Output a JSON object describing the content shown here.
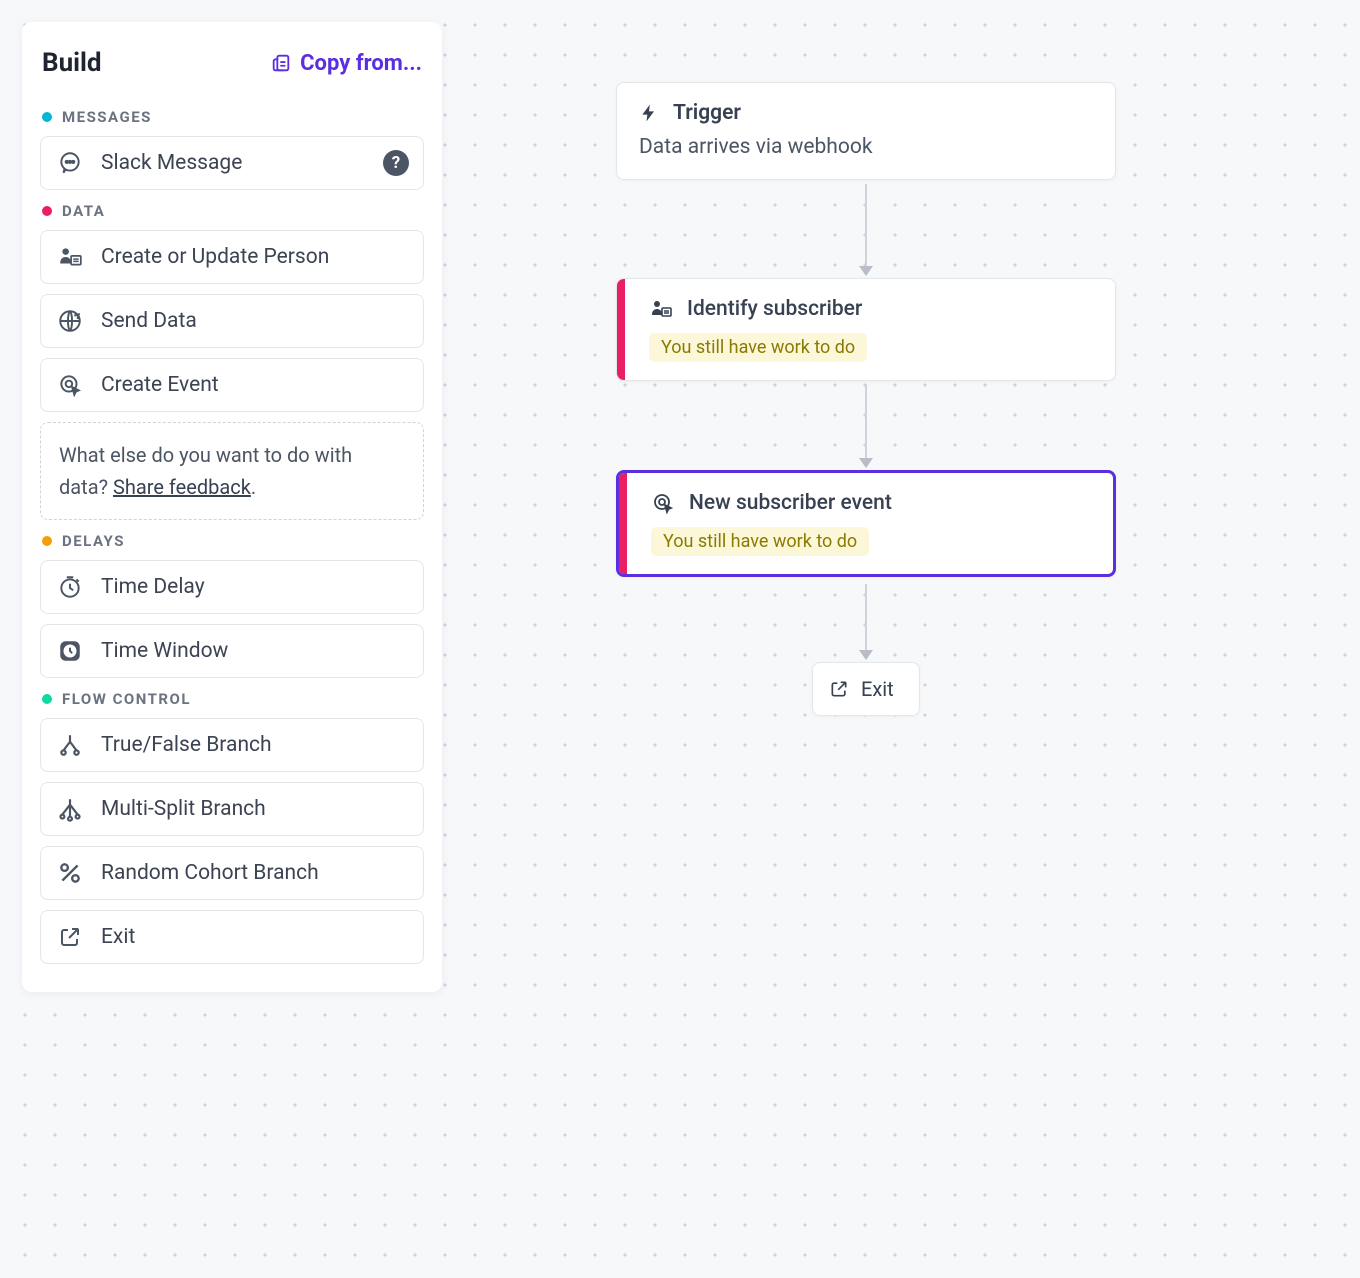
{
  "sidebar": {
    "title": "Build",
    "copy_from_label": "Copy from...",
    "sections": {
      "messages": {
        "label": "MESSAGES",
        "items": {
          "slack": "Slack Message"
        }
      },
      "data": {
        "label": "DATA",
        "items": {
          "create_person": "Create or Update Person",
          "send_data": "Send Data",
          "create_event": "Create Event"
        },
        "feedback_prefix": "What else do you want to do with data? ",
        "feedback_link": "Share feedback",
        "feedback_suffix": "."
      },
      "delays": {
        "label": "DELAYS",
        "items": {
          "time_delay": "Time Delay",
          "time_window": "Time Window"
        }
      },
      "flow": {
        "label": "FLOW CONTROL",
        "items": {
          "tf_branch": "True/False Branch",
          "multi_split": "Multi-Split Branch",
          "random_cohort": "Random Cohort Branch",
          "exit": "Exit"
        }
      }
    }
  },
  "canvas": {
    "trigger": {
      "title": "Trigger",
      "subtitle": "Data arrives via webhook"
    },
    "identify": {
      "title": "Identify subscriber",
      "warning": "You still have work to do"
    },
    "event": {
      "title": "New subscriber event",
      "warning": "You still have work to do"
    },
    "exit": {
      "label": "Exit"
    }
  }
}
